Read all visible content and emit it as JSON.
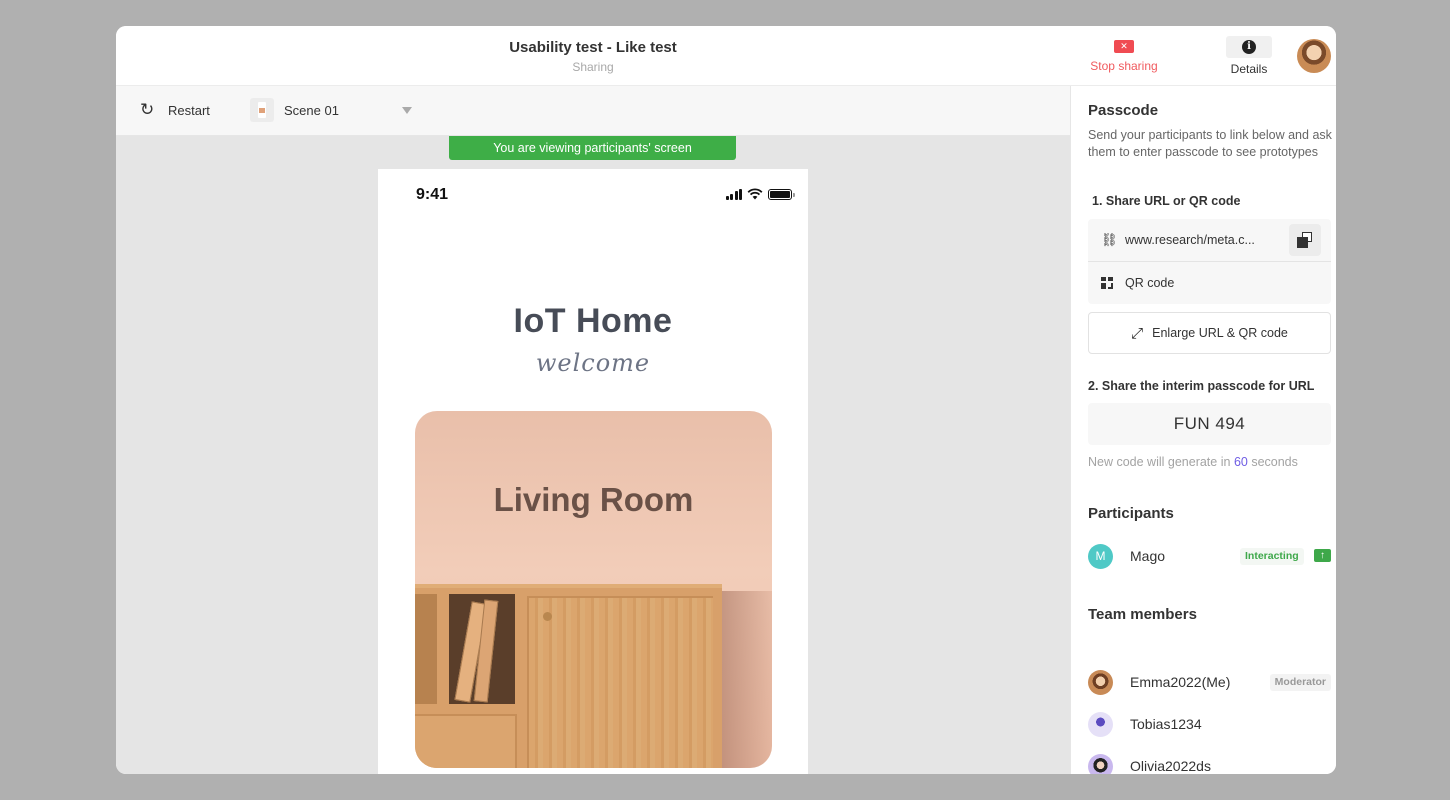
{
  "header": {
    "title": "Usability test - Like test",
    "subtitle": "Sharing",
    "stop_sharing_label": "Stop sharing",
    "stop_icon": "close-icon",
    "details_label": "Details",
    "details_icon": "info-icon"
  },
  "toolbar": {
    "restart_label": "Restart",
    "restart_icon": "↻",
    "scene_label": "Scene 01"
  },
  "canvas": {
    "banner": "You are viewing participants' screen",
    "phone": {
      "time": "9:41",
      "app_title": "IoT Home",
      "app_subtitle": "welcome",
      "card_title": "Living Room"
    }
  },
  "panel": {
    "passcode_heading": "Passcode",
    "description": "Send your participants to link below and ask them to enter passcode to see prototypes",
    "step1_label": "1. Share URL or QR code",
    "url": "www.research/meta.c...",
    "qr_label": "QR code",
    "enlarge_label": "Enlarge URL & QR code",
    "step2_label": "2. Share the interim passcode for URL",
    "passcode": "FUN 494",
    "timer_prefix": "New code will generate in",
    "timer_seconds": "60",
    "timer_suffix": "seconds",
    "participants_heading": "Participants",
    "participants": [
      {
        "initial": "M",
        "name": "Mago",
        "status": "Interacting",
        "color": "#4fc9c6"
      }
    ],
    "team_heading": "Team members",
    "team": [
      {
        "name": "Emma2022(Me)",
        "role": "Moderator"
      },
      {
        "name": "Tobias1234"
      },
      {
        "name": "Olivia2022ds"
      }
    ]
  },
  "colors": {
    "stop_red": "#f04b52",
    "success_green": "#3eae47",
    "timer_accent": "#6f5de4"
  }
}
